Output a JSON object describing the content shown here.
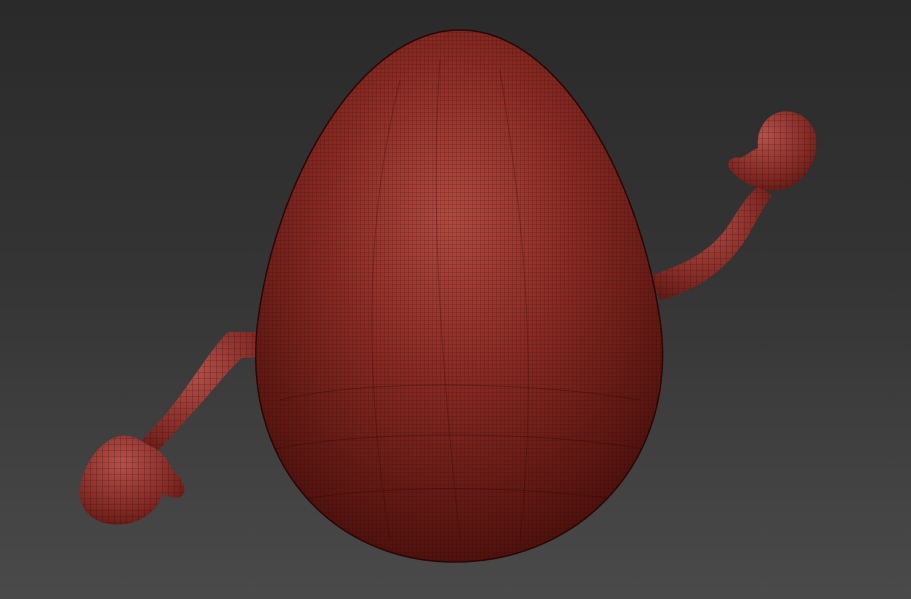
{
  "viewport": {
    "background_top": "#2a2a2a",
    "background_bottom": "#4a4a4a",
    "projection": "perspective",
    "shading": "wireframe-on-shaded"
  },
  "model": {
    "shape": "egg-character",
    "parts": [
      "body",
      "left-arm",
      "left-hand",
      "right-arm",
      "right-hand"
    ],
    "surface_color": "#8a2a22",
    "wire_color": "#2a0705",
    "highlight_color": "#c2564a"
  }
}
